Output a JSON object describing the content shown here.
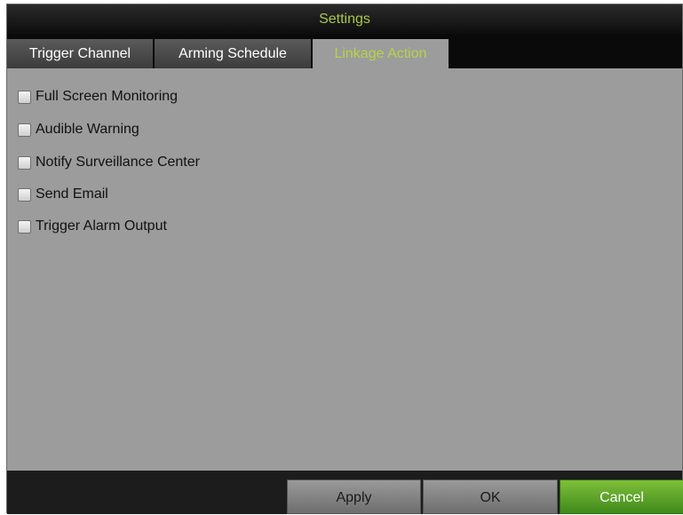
{
  "window": {
    "title": "Settings"
  },
  "tabs": [
    {
      "label": "Trigger Channel",
      "active": false
    },
    {
      "label": "Arming Schedule",
      "active": false
    },
    {
      "label": "Linkage Action",
      "active": true
    }
  ],
  "options": [
    {
      "label": "Full Screen Monitoring",
      "checked": false
    },
    {
      "label": "Audible Warning",
      "checked": false
    },
    {
      "label": "Notify Surveillance Center",
      "checked": false
    },
    {
      "label": "Send Email",
      "checked": false
    },
    {
      "label": "Trigger Alarm Output",
      "checked": false
    }
  ],
  "buttons": {
    "apply": "Apply",
    "ok": "OK",
    "cancel": "Cancel"
  },
  "colors": {
    "accent_text": "#a9c94a",
    "panel": "#9c9c9c",
    "cancel_button": "#5aa22a"
  }
}
